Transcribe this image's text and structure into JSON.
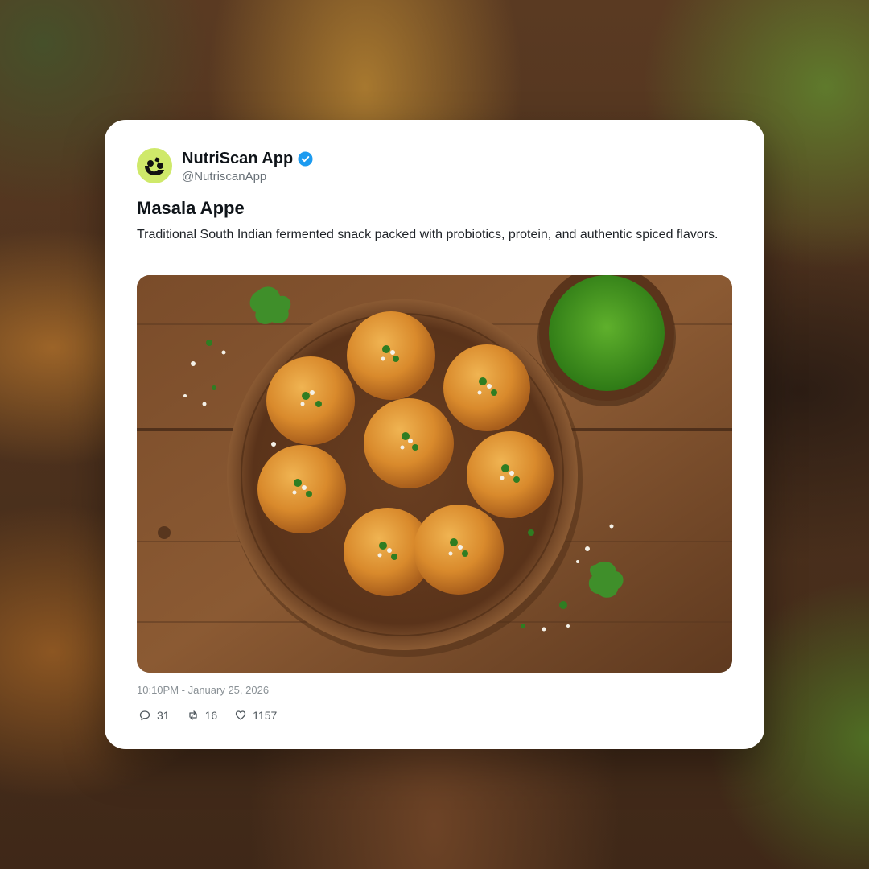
{
  "post": {
    "author_name": "NutriScan App",
    "handle": "@NutriscanApp",
    "verified": true,
    "title": "Masala Appe",
    "description": "Traditional South Indian fermented snack packed with probiotics, protein, and authentic spiced flavors.",
    "timestamp": "10:10PM - January 25, 2026",
    "stats": {
      "replies": "31",
      "reposts": "16",
      "likes": "1157"
    }
  },
  "icons": {
    "avatar": "nutriscan-logo-icon",
    "verified": "verified-badge-icon",
    "reply": "reply-icon",
    "repost": "repost-icon",
    "like": "heart-icon"
  },
  "colors": {
    "card_background": "#ffffff",
    "avatar_background": "#cfe96a",
    "verified_badge": "#1d9bf0",
    "name_text": "#0f1419",
    "meta_text": "#8a9196"
  }
}
